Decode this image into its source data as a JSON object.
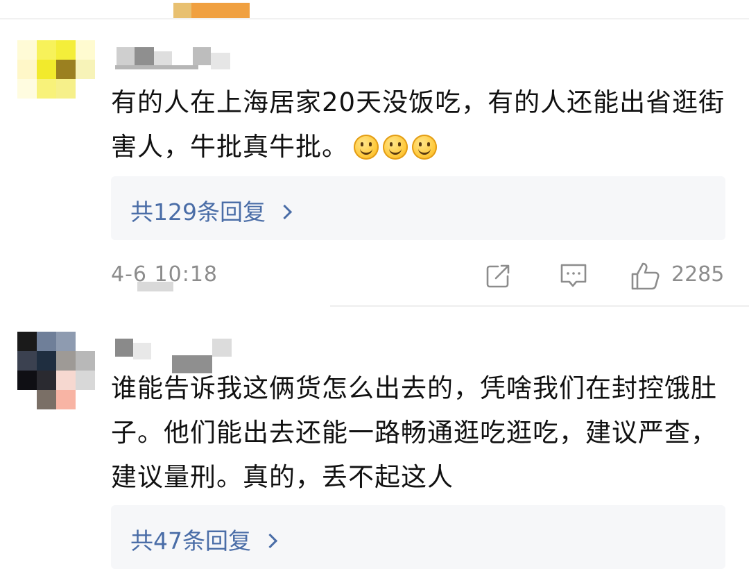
{
  "comments": [
    {
      "text": "有的人在上海居家20天没饭吃，有的人还能出省逛街害人，牛批真牛批。",
      "emoji": [
        "smiley",
        "smiley",
        "smiley"
      ],
      "replies_label": "共129条回复",
      "timestamp": "4-6 10:18",
      "like_count": "2285",
      "avatar_colors": [
        "#fffbd6",
        "#f7f25a",
        "#f4ee3a",
        "#fffbd0",
        "#fff7c8",
        "#f2ea2c",
        "#9b8020",
        "#f7f3b8",
        "#fffce0",
        "#f8f27a",
        "#f6f08a",
        "#ffffff",
        "#ffffff",
        "#ffffff",
        "#ffffff",
        "#ffffff"
      ]
    },
    {
      "text": "谁能告诉我这俩货怎么出去的，凭啥我们在封控饿肚子。他们能出去还能一路畅通逛吃逛吃，建议严查，建议量刑。真的，丢不起这人",
      "replies_label": "共47条回复",
      "avatar_colors": [
        "#1a1a1a",
        "#6f7f99",
        "#8e9bb0",
        "#ffffff",
        "#3b4150",
        "#1f2e40",
        "#9e9a96",
        "#b8b8b8",
        "#0f0f14",
        "#2a2a30",
        "#f6d8d0",
        "#d8d8d8",
        "#ffffff",
        "#7a6f66",
        "#f8b4a4",
        "#ffffff"
      ]
    }
  ],
  "colors": {
    "accent_link": "#4a6da7",
    "meta_gray": "#8c8c8c",
    "reply_bg": "#f6f7f9"
  },
  "icons": [
    "share-icon",
    "comment-icon",
    "like-icon",
    "chevron-right-icon",
    "smiley-emoji"
  ]
}
